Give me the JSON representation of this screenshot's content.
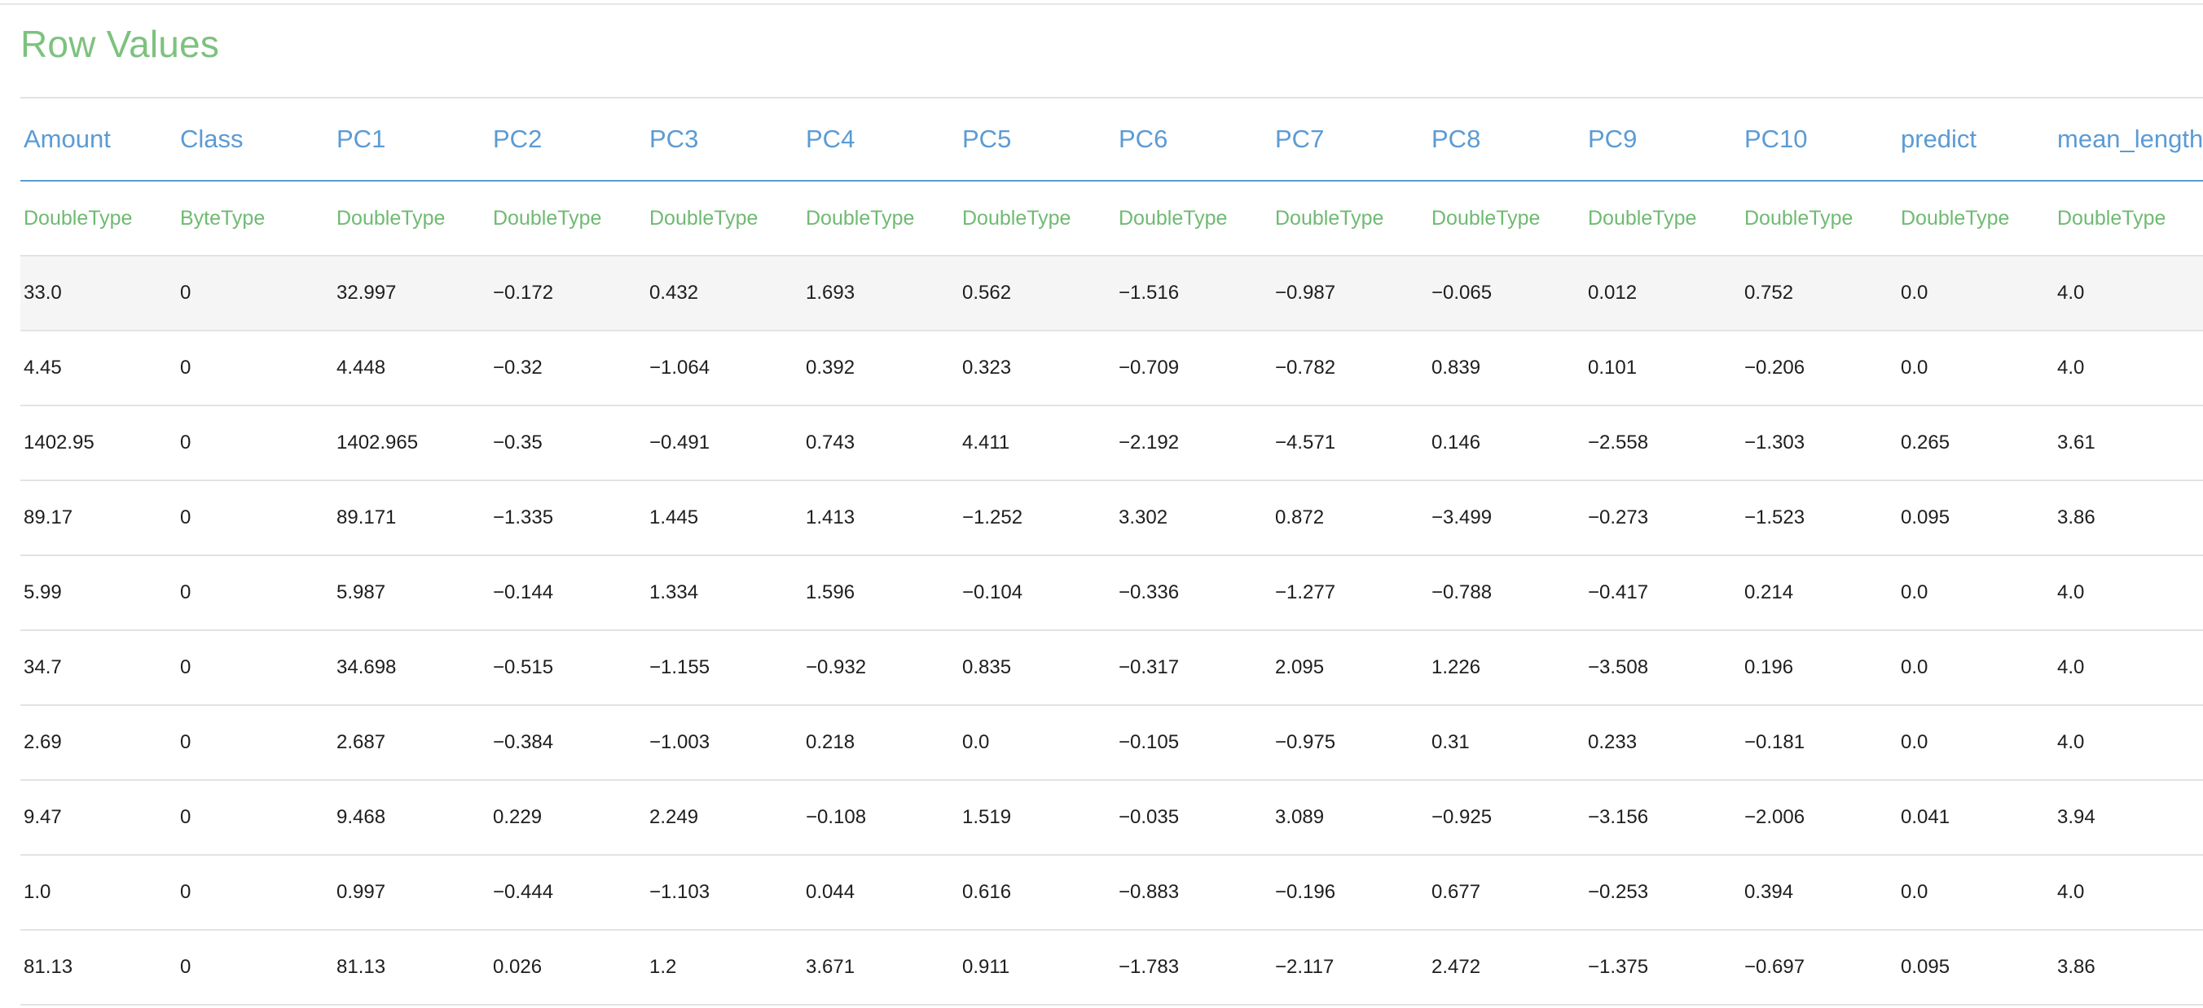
{
  "title": "Row Values",
  "columns": [
    "Amount",
    "Class",
    "PC1",
    "PC2",
    "PC3",
    "PC4",
    "PC5",
    "PC6",
    "PC7",
    "PC8",
    "PC9",
    "PC10",
    "predict",
    "mean_length"
  ],
  "types": [
    "DoubleType",
    "ByteType",
    "DoubleType",
    "DoubleType",
    "DoubleType",
    "DoubleType",
    "DoubleType",
    "DoubleType",
    "DoubleType",
    "DoubleType",
    "DoubleType",
    "DoubleType",
    "DoubleType",
    "DoubleType"
  ],
  "rows": [
    [
      "33.0",
      "0",
      "32.997",
      "−0.172",
      "0.432",
      "1.693",
      "0.562",
      "−1.516",
      "−0.987",
      "−0.065",
      "0.012",
      "0.752",
      "0.0",
      "4.0"
    ],
    [
      "4.45",
      "0",
      "4.448",
      "−0.32",
      "−1.064",
      "0.392",
      "0.323",
      "−0.709",
      "−0.782",
      "0.839",
      "0.101",
      "−0.206",
      "0.0",
      "4.0"
    ],
    [
      "1402.95",
      "0",
      "1402.965",
      "−0.35",
      "−0.491",
      "0.743",
      "4.411",
      "−2.192",
      "−4.571",
      "0.146",
      "−2.558",
      "−1.303",
      "0.265",
      "3.61"
    ],
    [
      "89.17",
      "0",
      "89.171",
      "−1.335",
      "1.445",
      "1.413",
      "−1.252",
      "3.302",
      "0.872",
      "−3.499",
      "−0.273",
      "−1.523",
      "0.095",
      "3.86"
    ],
    [
      "5.99",
      "0",
      "5.987",
      "−0.144",
      "1.334",
      "1.596",
      "−0.104",
      "−0.336",
      "−1.277",
      "−0.788",
      "−0.417",
      "0.214",
      "0.0",
      "4.0"
    ],
    [
      "34.7",
      "0",
      "34.698",
      "−0.515",
      "−1.155",
      "−0.932",
      "0.835",
      "−0.317",
      "2.095",
      "1.226",
      "−3.508",
      "0.196",
      "0.0",
      "4.0"
    ],
    [
      "2.69",
      "0",
      "2.687",
      "−0.384",
      "−1.003",
      "0.218",
      "0.0",
      "−0.105",
      "−0.975",
      "0.31",
      "0.233",
      "−0.181",
      "0.0",
      "4.0"
    ],
    [
      "9.47",
      "0",
      "9.468",
      "0.229",
      "2.249",
      "−0.108",
      "1.519",
      "−0.035",
      "3.089",
      "−0.925",
      "−3.156",
      "−2.006",
      "0.041",
      "3.94"
    ],
    [
      "1.0",
      "0",
      "0.997",
      "−0.444",
      "−1.103",
      "0.044",
      "0.616",
      "−0.883",
      "−0.196",
      "0.677",
      "−0.253",
      "0.394",
      "0.0",
      "4.0"
    ],
    [
      "81.13",
      "0",
      "81.13",
      "0.026",
      "1.2",
      "3.671",
      "0.911",
      "−1.783",
      "−2.117",
      "2.472",
      "−1.375",
      "−0.697",
      "0.095",
      "3.86"
    ]
  ],
  "highlighted_row": 0,
  "colors": {
    "title": "#7dc27f",
    "header": "#5b9bd5",
    "type": "#6fba72",
    "highlight_background": "#f5f5f5"
  }
}
